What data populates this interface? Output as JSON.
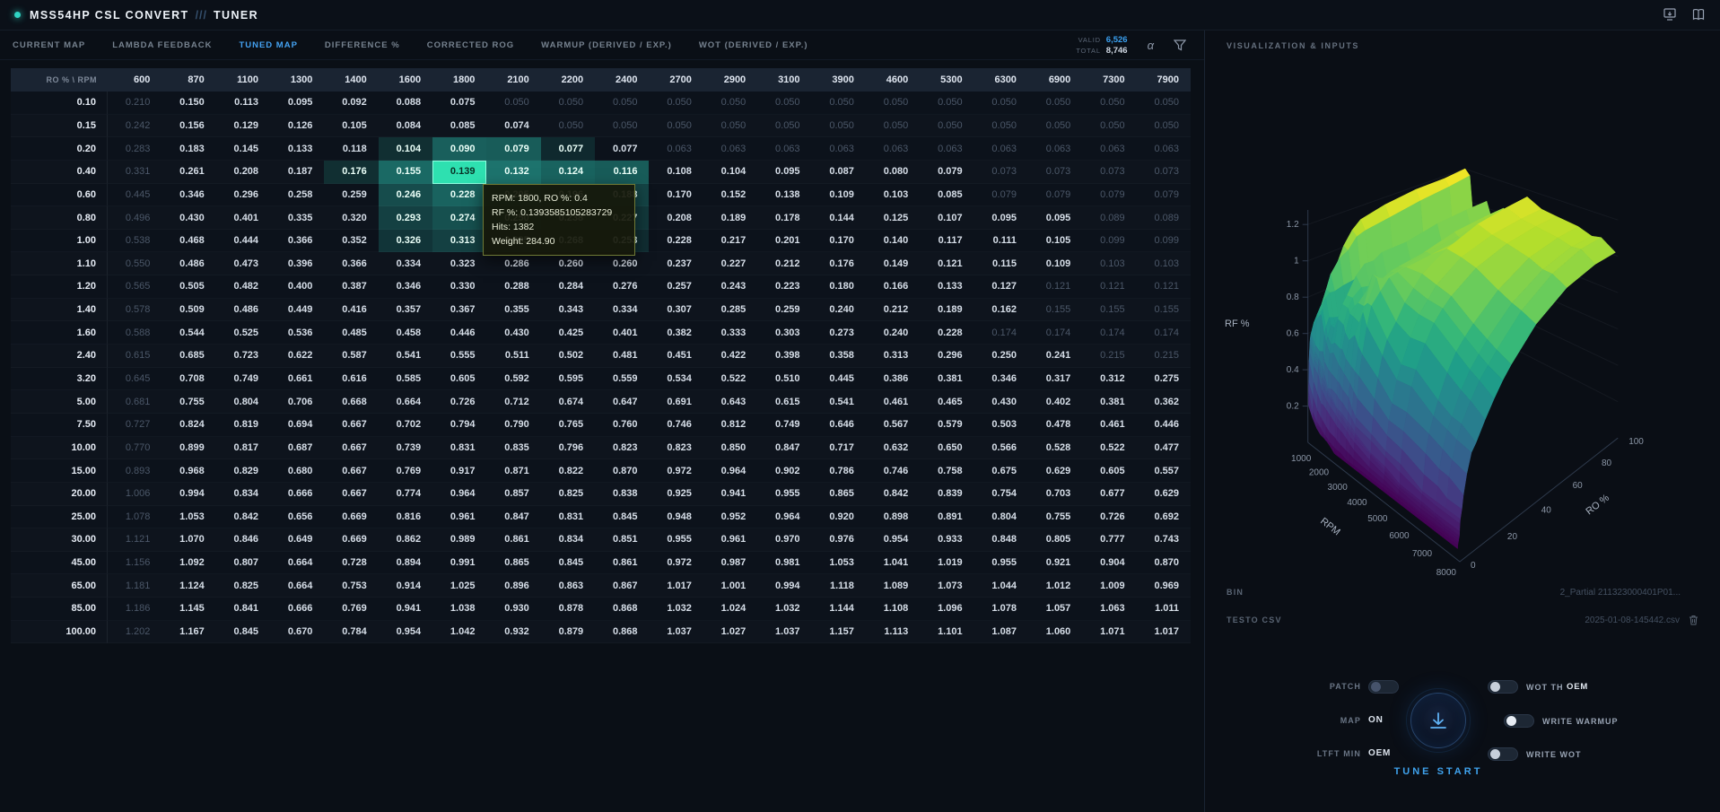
{
  "app": {
    "title": "MSS54HP CSL CONVERT",
    "separator": "///",
    "subtitle": "TUNER"
  },
  "tabs": [
    {
      "label": "CURRENT MAP",
      "active": false
    },
    {
      "label": "LAMBDA FEEDBACK",
      "active": false
    },
    {
      "label": "TUNED MAP",
      "active": true
    },
    {
      "label": "DIFFERENCE %",
      "active": false
    },
    {
      "label": "CORRECTED ROG",
      "active": false
    },
    {
      "label": "WARMUP (DERIVED / EXP.)",
      "active": false
    },
    {
      "label": "WOT (DERIVED / EXP.)",
      "active": false
    }
  ],
  "stats": {
    "valid_label": "VALID",
    "valid_value": "6,526",
    "total_label": "TOTAL",
    "total_value": "8,746"
  },
  "table": {
    "corner_label": "RO % \\ RPM",
    "row_labels": [
      "0.10",
      "0.15",
      "0.20",
      "0.40",
      "0.60",
      "0.80",
      "1.00",
      "1.10",
      "1.20",
      "1.40",
      "1.60",
      "2.40",
      "3.20",
      "5.00",
      "7.50",
      "10.00",
      "15.00",
      "20.00",
      "25.00",
      "30.00",
      "45.00",
      "65.00",
      "85.00",
      "100.00"
    ],
    "hover_cell": [
      3,
      6
    ],
    "highlights": [
      [
        2,
        5,
        0.15
      ],
      [
        2,
        6,
        0.4
      ],
      [
        2,
        7,
        0.38
      ],
      [
        2,
        8,
        0.12
      ],
      [
        3,
        4,
        0.15
      ],
      [
        3,
        5,
        0.45
      ],
      [
        3,
        7,
        0.5
      ],
      [
        3,
        8,
        0.42
      ],
      [
        3,
        9,
        0.38
      ],
      [
        4,
        5,
        0.3
      ],
      [
        4,
        6,
        0.42
      ],
      [
        4,
        7,
        0.34
      ],
      [
        4,
        8,
        0.3
      ],
      [
        4,
        9,
        0.26
      ],
      [
        5,
        5,
        0.24
      ],
      [
        5,
        6,
        0.32
      ],
      [
        5,
        7,
        0.26
      ],
      [
        5,
        8,
        0.22
      ],
      [
        5,
        9,
        0.2
      ],
      [
        6,
        5,
        0.18
      ],
      [
        6,
        6,
        0.24
      ],
      [
        6,
        7,
        0.18
      ],
      [
        6,
        8,
        0.15
      ],
      [
        6,
        9,
        0.14
      ]
    ],
    "highlight_rgb": "45,212,191"
  },
  "tooltip": {
    "lines": [
      "RPM: 1800, RO %: 0.4",
      "RF %: 0.1393585105283729",
      "Hits: 1382",
      "Weight: 284.90"
    ]
  },
  "chart_data": {
    "type": "surface",
    "title": "",
    "xlabel": "RPM",
    "ylabel": "RO %",
    "zlabel": "RF %",
    "colormap": "viridis",
    "x_rpm": [
      600,
      870,
      1100,
      1300,
      1400,
      1600,
      1800,
      2100,
      2200,
      2400,
      2700,
      2900,
      3100,
      3900,
      4600,
      5300,
      6300,
      6900,
      7300,
      7900
    ],
    "y_ro": [
      0.1,
      0.15,
      0.2,
      0.4,
      0.6,
      0.8,
      1.0,
      1.1,
      1.2,
      1.4,
      1.6,
      2.4,
      3.2,
      5.0,
      7.5,
      10.0,
      15.0,
      20.0,
      25.0,
      30.0,
      45.0,
      65.0,
      85.0,
      100.0
    ],
    "x_ticks": [
      1000,
      2000,
      3000,
      4000,
      5000,
      6000,
      7000,
      8000
    ],
    "y_ticks": [
      0,
      20,
      40,
      60,
      80,
      100
    ],
    "z_ticks": [
      0.2,
      0.4,
      0.6,
      0.8,
      1,
      1.2
    ],
    "values": [
      [
        0.21,
        0.15,
        0.113,
        0.095,
        0.092,
        0.088,
        0.075,
        0.05,
        0.05,
        0.05,
        0.05,
        0.05,
        0.05,
        0.05,
        0.05,
        0.05,
        0.05,
        0.05,
        0.05,
        0.05
      ],
      [
        0.242,
        0.156,
        0.129,
        0.126,
        0.105,
        0.084,
        0.085,
        0.074,
        0.05,
        0.05,
        0.05,
        0.05,
        0.05,
        0.05,
        0.05,
        0.05,
        0.05,
        0.05,
        0.05,
        0.05
      ],
      [
        0.283,
        0.183,
        0.145,
        0.133,
        0.118,
        0.104,
        0.09,
        0.079,
        0.077,
        0.077,
        0.063,
        0.063,
        0.063,
        0.063,
        0.063,
        0.063,
        0.063,
        0.063,
        0.063,
        0.063
      ],
      [
        0.331,
        0.261,
        0.208,
        0.187,
        0.176,
        0.155,
        0.139,
        0.132,
        0.124,
        0.116,
        0.108,
        0.104,
        0.095,
        0.087,
        0.08,
        0.079,
        0.073,
        0.073,
        0.073,
        0.073
      ],
      [
        0.445,
        0.346,
        0.296,
        0.258,
        0.259,
        0.246,
        0.228,
        0.205,
        0.196,
        0.188,
        0.17,
        0.152,
        0.138,
        0.109,
        0.103,
        0.085,
        0.079,
        0.079,
        0.079,
        0.079
      ],
      [
        0.496,
        0.43,
        0.401,
        0.335,
        0.32,
        0.293,
        0.274,
        0.25,
        0.238,
        0.227,
        0.208,
        0.189,
        0.178,
        0.144,
        0.125,
        0.107,
        0.095,
        0.095,
        0.089,
        0.089
      ],
      [
        0.538,
        0.468,
        0.444,
        0.366,
        0.352,
        0.326,
        0.313,
        0.285,
        0.268,
        0.253,
        0.228,
        0.217,
        0.201,
        0.17,
        0.14,
        0.117,
        0.111,
        0.105,
        0.099,
        0.099
      ],
      [
        0.55,
        0.486,
        0.473,
        0.396,
        0.366,
        0.334,
        0.323,
        0.286,
        0.26,
        0.26,
        0.237,
        0.227,
        0.212,
        0.176,
        0.149,
        0.121,
        0.115,
        0.109,
        0.103,
        0.103
      ],
      [
        0.565,
        0.505,
        0.482,
        0.4,
        0.387,
        0.346,
        0.33,
        0.288,
        0.284,
        0.276,
        0.257,
        0.243,
        0.223,
        0.18,
        0.166,
        0.133,
        0.127,
        0.121,
        0.121,
        0.121
      ],
      [
        0.578,
        0.509,
        0.486,
        0.449,
        0.416,
        0.357,
        0.367,
        0.355,
        0.343,
        0.334,
        0.307,
        0.285,
        0.259,
        0.24,
        0.212,
        0.189,
        0.162,
        0.155,
        0.155,
        0.155
      ],
      [
        0.588,
        0.544,
        0.525,
        0.536,
        0.485,
        0.458,
        0.446,
        0.43,
        0.425,
        0.401,
        0.382,
        0.333,
        0.303,
        0.273,
        0.24,
        0.228,
        0.174,
        0.174,
        0.174,
        0.174
      ],
      [
        0.615,
        0.685,
        0.723,
        0.622,
        0.587,
        0.541,
        0.555,
        0.511,
        0.502,
        0.481,
        0.451,
        0.422,
        0.398,
        0.358,
        0.313,
        0.296,
        0.25,
        0.241,
        0.215,
        0.215
      ],
      [
        0.645,
        0.708,
        0.749,
        0.661,
        0.616,
        0.585,
        0.605,
        0.592,
        0.595,
        0.559,
        0.534,
        0.522,
        0.51,
        0.445,
        0.386,
        0.381,
        0.346,
        0.317,
        0.312,
        0.275
      ],
      [
        0.681,
        0.755,
        0.804,
        0.706,
        0.668,
        0.664,
        0.726,
        0.712,
        0.674,
        0.647,
        0.691,
        0.643,
        0.615,
        0.541,
        0.461,
        0.465,
        0.43,
        0.402,
        0.381,
        0.362
      ],
      [
        0.727,
        0.824,
        0.819,
        0.694,
        0.667,
        0.702,
        0.794,
        0.79,
        0.765,
        0.76,
        0.746,
        0.812,
        0.749,
        0.646,
        0.567,
        0.579,
        0.503,
        0.478,
        0.461,
        0.446
      ],
      [
        0.77,
        0.899,
        0.817,
        0.687,
        0.667,
        0.739,
        0.831,
        0.835,
        0.796,
        0.823,
        0.823,
        0.85,
        0.847,
        0.717,
        0.632,
        0.65,
        0.566,
        0.528,
        0.522,
        0.477
      ],
      [
        0.893,
        0.968,
        0.829,
        0.68,
        0.667,
        0.769,
        0.917,
        0.871,
        0.822,
        0.87,
        0.972,
        0.964,
        0.902,
        0.786,
        0.746,
        0.758,
        0.675,
        0.629,
        0.605,
        0.557
      ],
      [
        1.006,
        0.994,
        0.834,
        0.666,
        0.667,
        0.774,
        0.964,
        0.857,
        0.825,
        0.838,
        0.925,
        0.941,
        0.955,
        0.865,
        0.842,
        0.839,
        0.754,
        0.703,
        0.677,
        0.629
      ],
      [
        1.078,
        1.053,
        0.842,
        0.656,
        0.669,
        0.816,
        0.961,
        0.847,
        0.831,
        0.845,
        0.948,
        0.952,
        0.964,
        0.92,
        0.898,
        0.891,
        0.804,
        0.755,
        0.726,
        0.692
      ],
      [
        1.121,
        1.07,
        0.846,
        0.649,
        0.669,
        0.862,
        0.989,
        0.861,
        0.834,
        0.851,
        0.955,
        0.961,
        0.97,
        0.976,
        0.954,
        0.933,
        0.848,
        0.805,
        0.777,
        0.743
      ],
      [
        1.156,
        1.092,
        0.807,
        0.664,
        0.728,
        0.894,
        0.991,
        0.865,
        0.845,
        0.861,
        0.972,
        0.987,
        0.981,
        1.053,
        1.041,
        1.019,
        0.955,
        0.921,
        0.904,
        0.87
      ],
      [
        1.181,
        1.124,
        0.825,
        0.664,
        0.753,
        0.914,
        1.025,
        0.896,
        0.863,
        0.867,
        1.017,
        1.001,
        0.994,
        1.118,
        1.089,
        1.073,
        1.044,
        1.012,
        1.009,
        0.969
      ],
      [
        1.186,
        1.145,
        0.841,
        0.666,
        0.769,
        0.941,
        1.038,
        0.93,
        0.878,
        0.868,
        1.032,
        1.024,
        1.032,
        1.144,
        1.108,
        1.096,
        1.078,
        1.057,
        1.063,
        1.011
      ],
      [
        1.202,
        1.167,
        0.845,
        0.67,
        0.784,
        0.954,
        1.042,
        0.932,
        0.879,
        0.868,
        1.037,
        1.027,
        1.037,
        1.157,
        1.113,
        1.101,
        1.087,
        1.06,
        1.071,
        1.017
      ]
    ]
  },
  "viz": {
    "title": "VISUALIZATION & INPUTS"
  },
  "files": {
    "bin_label": "BIN",
    "bin_value": "2_Partial 211323000401P01...",
    "csv_label": "TESTO CSV",
    "csv_value": "2025-01-08-145442.csv"
  },
  "controls": {
    "patch_label": "PATCH",
    "map_label": "MAP",
    "map_value": "ON",
    "ltft_label": "LTFT MIN",
    "ltft_value": "OEM",
    "wot_th_label": "WOT TH",
    "wot_th_value": "OEM",
    "write_warmup_label": "WRITE WARMUP",
    "write_wot_label": "WRITE WOT",
    "tune_start_label": "TUNE START"
  },
  "colors": {
    "accent_blue": "#3aa0f0",
    "teal": "#2dd4bf",
    "active_tab": "#44a2f2"
  }
}
